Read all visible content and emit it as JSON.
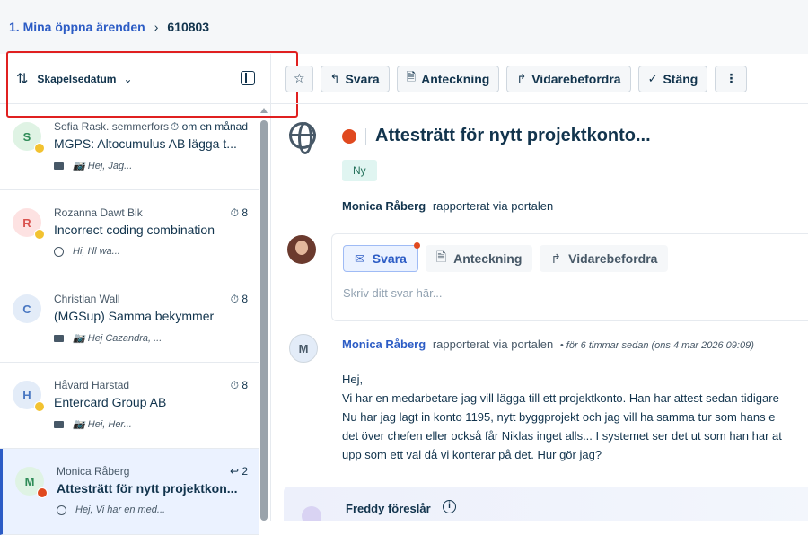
{
  "breadcrumb": {
    "link": "1. Mina öppna ärenden",
    "sep": "›",
    "current": "610803"
  },
  "sort": {
    "icon": "sort-arrows-icon",
    "label": "Skapelsedatum"
  },
  "tickets": [
    {
      "initial": "S",
      "avatar_bg": "#dff3e4",
      "avatar_fg": "#2e8b57",
      "mood": "#f2c230",
      "name": "Sofia Rask. semmerfors",
      "meta": "⏱ om en månad",
      "subject": "MGPS: Altocumulus AB lägga t...",
      "snippet": "📷 Hej,  Jag...",
      "channel": "email"
    },
    {
      "initial": "R",
      "avatar_bg": "#fde2e2",
      "avatar_fg": "#d9534f",
      "mood": "#f2c230",
      "name": "Rozanna Dawt Bik",
      "meta": "⏱ 8",
      "subject": "Incorrect coding combination",
      "snippet": "Hi, I'll wa...",
      "channel": "portal"
    },
    {
      "initial": "C",
      "avatar_bg": "#e3ecf8",
      "avatar_fg": "#4a78c2",
      "mood": "",
      "name": "Christian Wall",
      "meta": "⏱ 8",
      "subject": "(MGSup) Samma bekymmer",
      "snippet": "📷 Hej Cazandra,  ...",
      "channel": "email"
    },
    {
      "initial": "H",
      "avatar_bg": "#e3ecf8",
      "avatar_fg": "#4a78c2",
      "mood": "#f2c230",
      "name": "Håvard Harstad",
      "meta": "⏱ 8",
      "subject": "Entercard Group AB",
      "snippet": "📷 Hei, Her...",
      "channel": "email"
    },
    {
      "initial": "M",
      "avatar_bg": "#dff3e4",
      "avatar_fg": "#2e8b57",
      "mood": "#e0491f",
      "name": "Monica Råberg",
      "meta": "↩ 2",
      "subject": "Attesträtt för nytt projektkon...",
      "snippet": "Hej, Vi har en med...",
      "channel": "portal",
      "active": true
    }
  ],
  "toolbar": {
    "reply": "Svara",
    "note": "Anteckning",
    "forward": "Vidarebefordra",
    "close": "Stäng"
  },
  "ticket": {
    "subject": "Attesträtt för nytt projektkonto...",
    "status": "Ny",
    "reporter_name": "Monica Råberg",
    "reporter_via": "rapporterat via portalen"
  },
  "reply_box": {
    "tab_reply": "Svara",
    "tab_note": "Anteckning",
    "tab_forward": "Vidarebefordra",
    "placeholder": "Skriv ditt svar här..."
  },
  "message": {
    "avatar": "M",
    "author": "Monica Råberg",
    "via": "rapporterat via portalen",
    "time": "•  för 6 timmar sedan (ons 4 mar 2026 09:09)",
    "lines": [
      "Hej,",
      "Vi har en medarbetare jag vill lägga till ett projektkonto. Han har attest sedan tidigare",
      "Nu har jag lagt in konto 1195, nytt byggprojekt och jag vill ha samma tur som hans e",
      "det över chefen eller också får Niklas inget alls... I systemet ser det ut som han har at",
      "upp som ett val då vi konterar på det. Hur gör jag?"
    ]
  },
  "freddy": {
    "title": "Freddy föreslår"
  },
  "colors": {
    "accent": "#2c5cc5",
    "alert": "#e02020"
  }
}
